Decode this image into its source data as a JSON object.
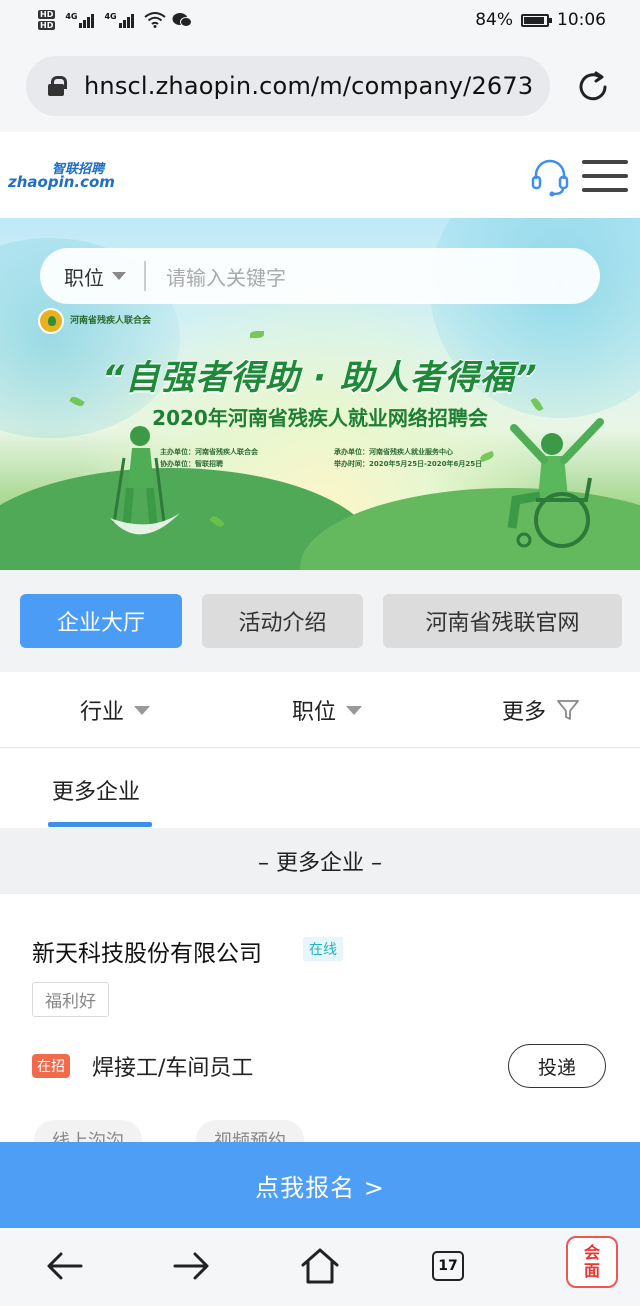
{
  "status_bar": {
    "hd_labels": [
      "HD",
      "HD"
    ],
    "network": [
      "4G",
      "4G"
    ],
    "battery": "84%",
    "battery_level": 0.84,
    "time": "10:06"
  },
  "browser": {
    "url": "hnscl.zhaopin.com/m/company/2673",
    "tab_count": "17"
  },
  "site": {
    "logo_cn": "智联招聘",
    "logo_en": "zhaopin.com"
  },
  "banner": {
    "search_select": "职位",
    "search_placeholder": "请输入关键字",
    "org_name": "河南省残疾人联合会",
    "slogan": "“自强者得助 · 助人者得福”",
    "subtitle": "2020年河南省残疾人就业网络招聘会",
    "meta": [
      "主办单位：河南省残疾人联合会",
      "承办单位：河南省残疾人就业服务中心",
      "协办单位：智联招聘",
      "举办时间：2020年5月25日-2020年6月25日"
    ]
  },
  "tabs": [
    "企业大厅",
    "活动介绍",
    "河南省残联官网"
  ],
  "filters": [
    "行业",
    "职位",
    "更多"
  ],
  "section_tab": "更多企业",
  "section_header": "– 更多企业 –",
  "company": {
    "name": "新天科技股份有限公司",
    "status": "在线",
    "tag": "福利好",
    "hiring_badge": "在招",
    "job": "焊接工/车间员工",
    "apply": "投递",
    "chips": [
      "线上沟沟",
      "视频预约"
    ]
  },
  "signup": "点我报名 >",
  "stamp": [
    "会",
    "面"
  ],
  "colors": {
    "primary": "#4a9cf5",
    "signup": "#4f9ef5",
    "hiring": "#ef6b4c",
    "online": "#2ab1c4"
  }
}
